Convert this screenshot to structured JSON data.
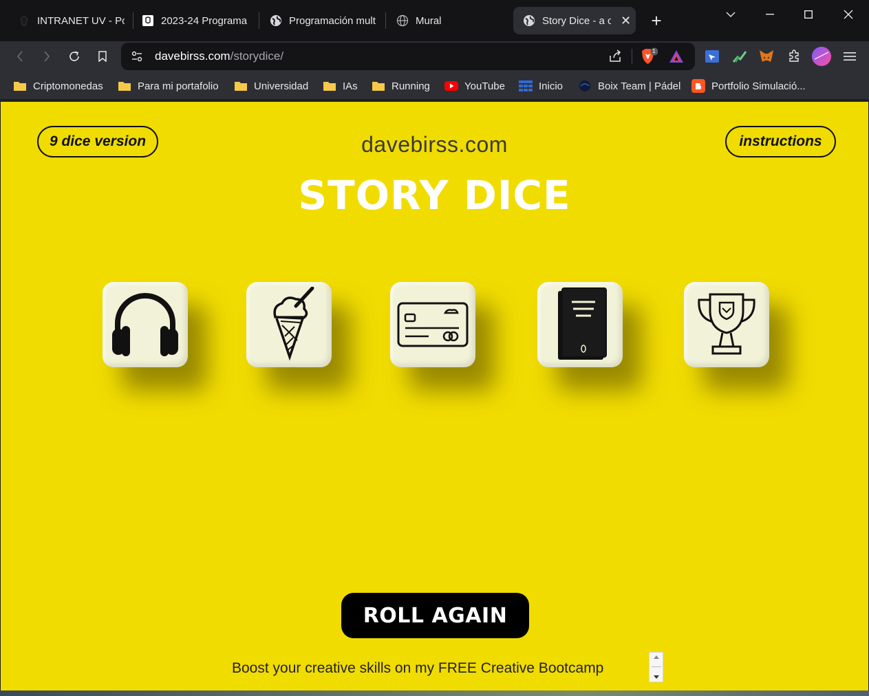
{
  "browser": {
    "tabs": [
      {
        "title": "INTRANET UV - Por",
        "active": false
      },
      {
        "title": "2023-24 Programa",
        "active": false
      },
      {
        "title": "Programación mult",
        "active": false
      },
      {
        "title": "Mural",
        "active": false
      },
      {
        "title": "Story Dice - a c",
        "active": true
      }
    ],
    "new_tab_symbol": "+",
    "url": {
      "host": "davebirss.com",
      "path": "/storydice/"
    },
    "brave_shield_count": "1",
    "bookmarks": [
      {
        "label": "Criptomonedas",
        "icon": "folder-icon"
      },
      {
        "label": "Para mi portafolio",
        "icon": "folder-icon"
      },
      {
        "label": "Universidad",
        "icon": "folder-icon"
      },
      {
        "label": "IAs",
        "icon": "folder-icon"
      },
      {
        "label": "Running",
        "icon": "folder-icon"
      },
      {
        "label": "YouTube",
        "icon": "youtube-icon"
      },
      {
        "label": "Inicio",
        "icon": "grid-icon"
      },
      {
        "label": "Boix Team | Pádel",
        "icon": "circle-icon"
      },
      {
        "label": "Portfolio Simulació...",
        "icon": "blogger-icon"
      }
    ]
  },
  "page": {
    "left_button": "9 dice version",
    "right_button": "instructions",
    "site_name": "davebirss.com",
    "title": "STORY DICE",
    "dice": [
      "headphones-icon",
      "ice-cream-icon",
      "credit-card-icon",
      "book-icon",
      "trophy-icon"
    ],
    "roll_button": "ROLL AGAIN",
    "promo_text": "Boost your creative skills on my FREE Creative Bootcamp",
    "colors": {
      "background": "#f1dc00",
      "die_face": "#f1f2d7",
      "button": "#000000",
      "title": "#ffffff"
    }
  }
}
